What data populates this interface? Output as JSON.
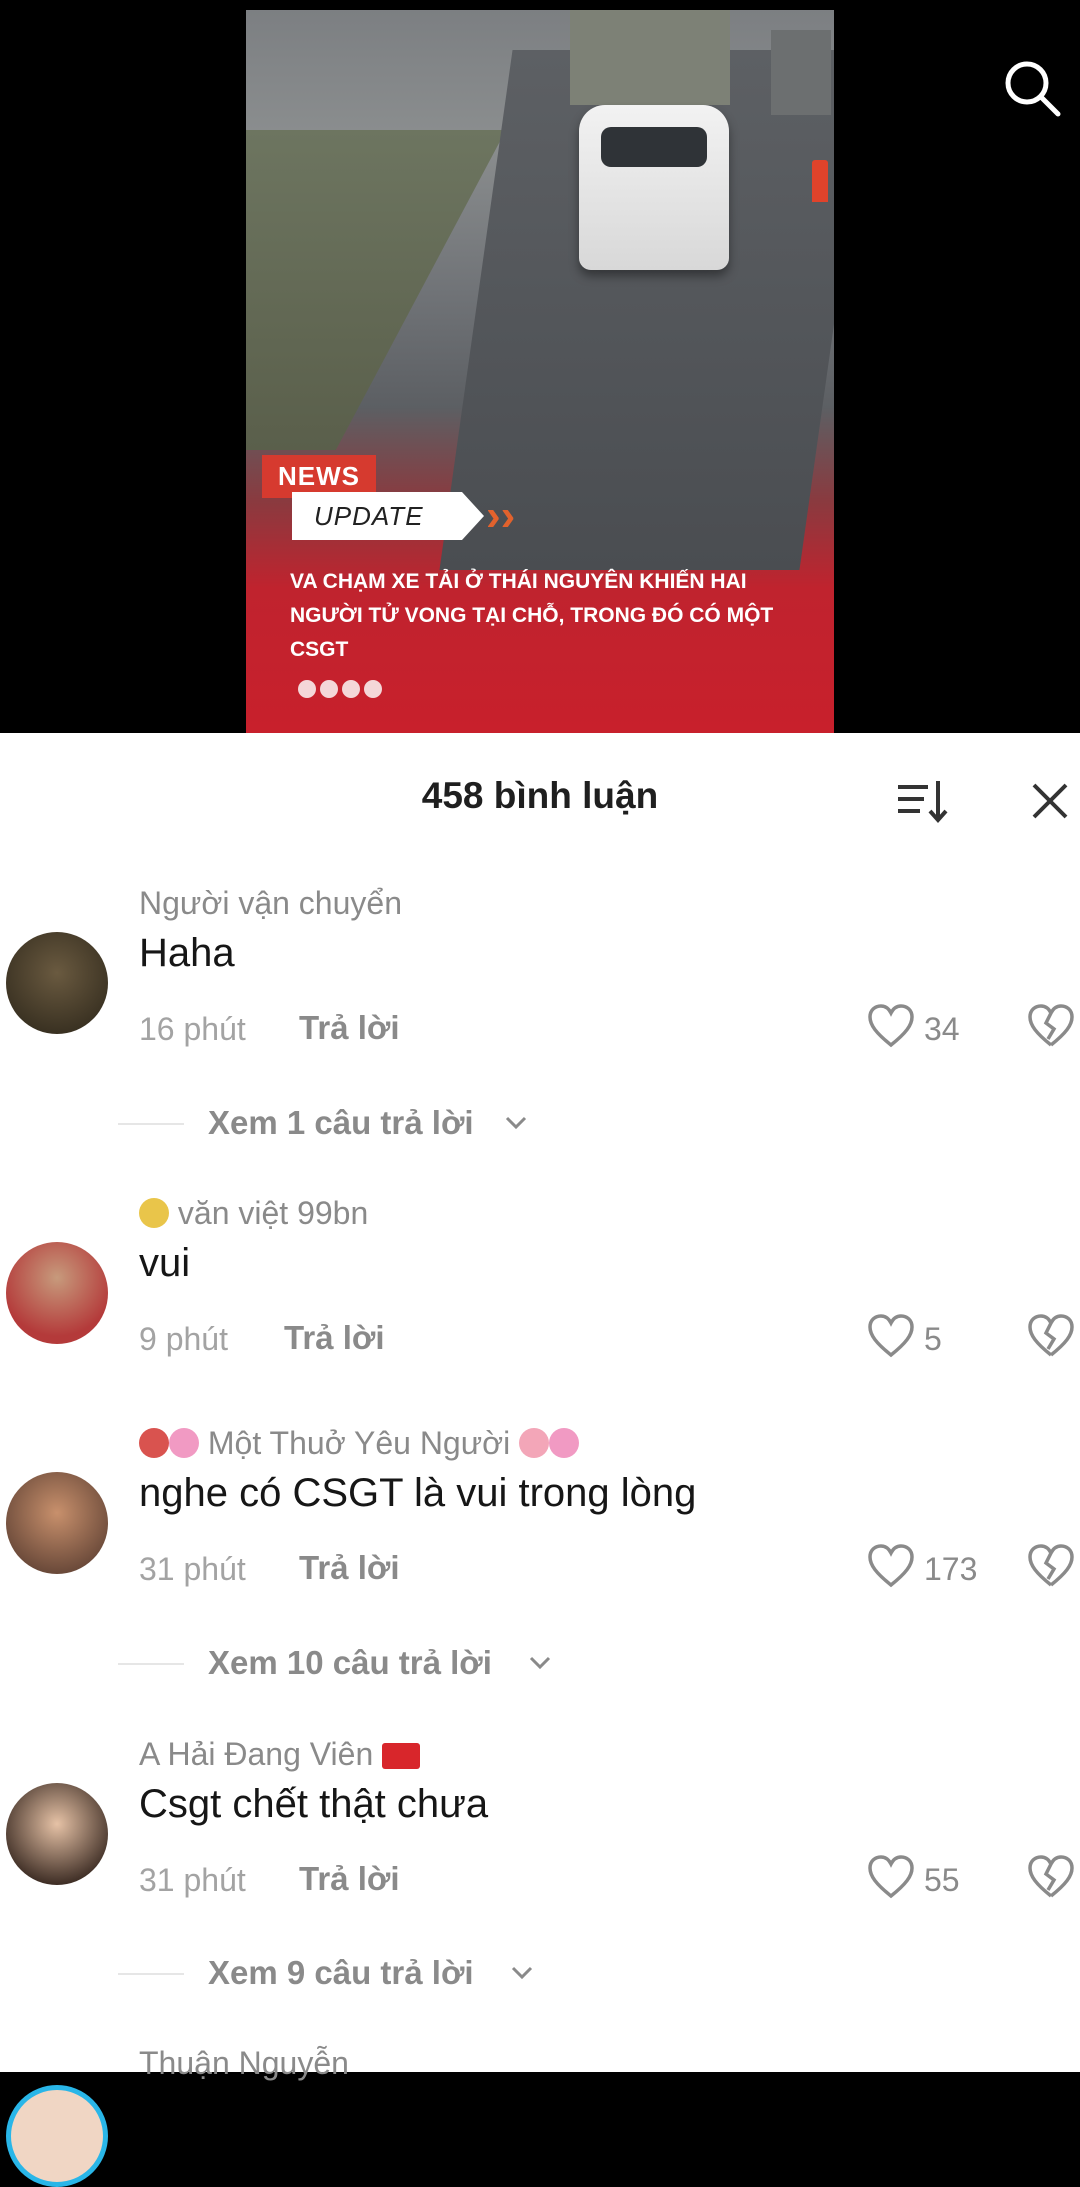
{
  "video": {
    "news_tag": "NEWS",
    "update_tag": "UPDATE",
    "headline": "VA CHẠM XE TẢI Ở THÁI NGUYÊN KHIẾN HAI NGƯỜI TỬ VONG TẠI CHỖ, TRONG ĐÓ CÓ MỘT CSGT"
  },
  "search_icon": "search-icon",
  "comments_sheet": {
    "title": "458 bình luận",
    "sort_icon": "sort-icon",
    "close_icon": "close-icon",
    "comments": [
      {
        "name": "Người vận chuyển",
        "text": "Haha",
        "time": "16 phút",
        "reply": "Trả lời",
        "likes": "34",
        "view_replies": "Xem 1 câu trả lời"
      },
      {
        "name": "văn việt 99bn",
        "text": "vui",
        "time": "9 phút",
        "reply": "Trả lời",
        "likes": "5"
      },
      {
        "name": "Một Thuở Yêu Người",
        "text": "nghe có CSGT là vui trong lòng",
        "time": "31 phút",
        "reply": "Trả lời",
        "likes": "173",
        "view_replies": "Xem 10 câu trả lời"
      },
      {
        "name": "A Hải Đang Viên",
        "text": "Csgt chết thật chưa",
        "time": "31 phút",
        "reply": "Trả lời",
        "likes": "55",
        "view_replies": "Xem 9 câu trả lời"
      },
      {
        "name": "Thuận Nguyễn"
      }
    ]
  },
  "colors": {
    "accent_red": "#c8202c",
    "text_gray": "#8a8a8a"
  }
}
